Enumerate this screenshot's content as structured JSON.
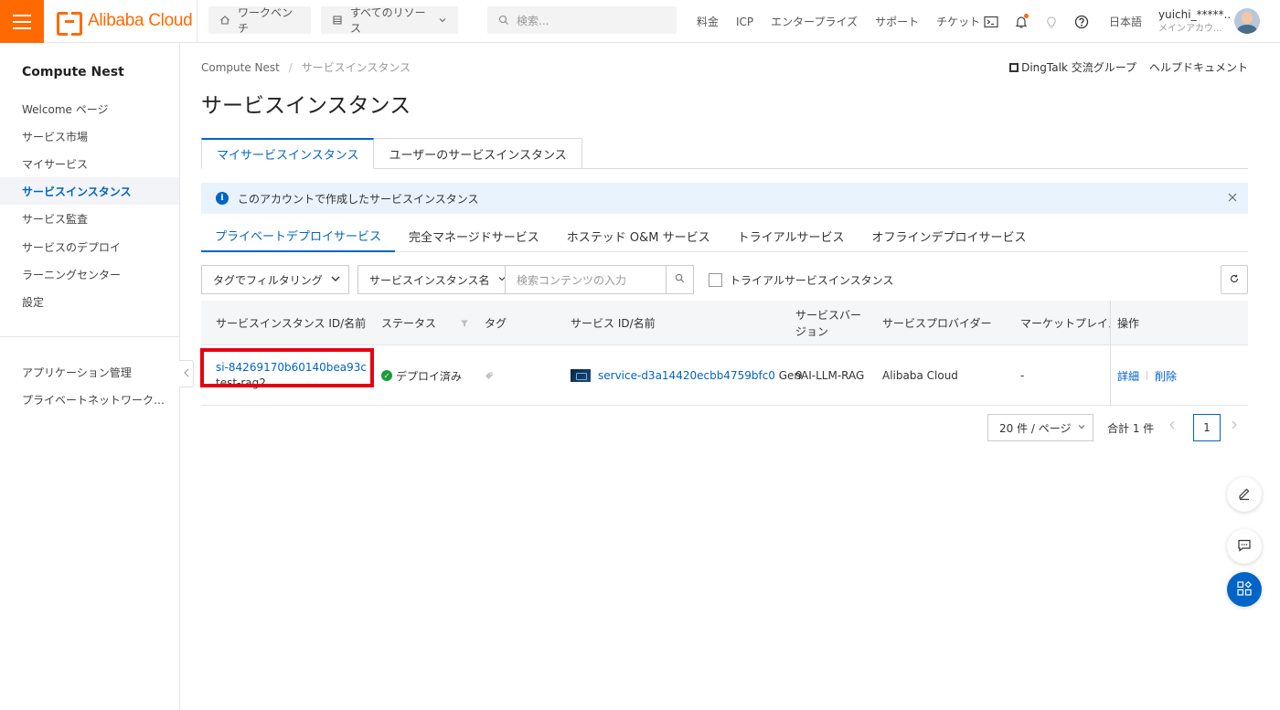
{
  "topbar": {
    "brand": "Alibaba Cloud",
    "workbench": "ワークベンチ",
    "resources": "すべてのリソース",
    "search_placeholder": "検索...",
    "links": [
      "料金",
      "ICP",
      "エンタープライズ",
      "サポート",
      "チケット"
    ],
    "language": "日本語",
    "user_name": "yuichi_*****...",
    "user_role": "メインアカウ..."
  },
  "sidebar": {
    "title": "Compute Nest",
    "items": [
      {
        "label": "Welcome ページ"
      },
      {
        "label": "サービス市場"
      },
      {
        "label": "マイサービス"
      },
      {
        "label": "サービスインスタンス"
      },
      {
        "label": "サービス監査"
      },
      {
        "label": "サービスのデプロイ"
      },
      {
        "label": "ラーニングセンター"
      },
      {
        "label": "設定"
      }
    ],
    "bottom_items": [
      {
        "label": "アプリケーション管理"
      },
      {
        "label": "プライベートネットワーク…"
      }
    ]
  },
  "breadcrumb": {
    "root": "Compute Nest",
    "current": "サービスインスタンス"
  },
  "help": {
    "dingtalk": "DingTalk 交流グループ",
    "docs": "ヘルプドキュメント"
  },
  "page_title": "サービスインスタンス",
  "tabs": [
    "マイサービスインスタンス",
    "ユーザーのサービスインスタンス"
  ],
  "notice": "このアカウントで作成したサービスインスタンス",
  "subtabs": [
    "プライベートデプロイサービス",
    "完全マネージドサービス",
    "ホステッド O&M サービス",
    "トライアルサービス",
    "オフラインデプロイサービス"
  ],
  "toolbar": {
    "tag_filter": "タグでフィルタリング",
    "field_select": "サービスインスタンス名",
    "search_placeholder": "検索コンテンツの入力",
    "trial_checkbox": "トライアルサービスインスタンス"
  },
  "table": {
    "headers": {
      "id": "サービスインスタンス ID/名前",
      "status": "ステータス",
      "tag": "タグ",
      "service": "サービス ID/名前",
      "version": "サービスバージョン",
      "provider": "サービスプロバイダー",
      "market": "マーケットプレイス",
      "ops": "操作"
    },
    "rows": [
      {
        "id": "si-84269170b60140bea93c",
        "name": "test-rag2",
        "status": "デプロイ済み",
        "service_id": "service-d3a14420ecbb4759bfc0",
        "service_name": "GenAI-LLM-RAG",
        "version": "9",
        "provider": "Alibaba Cloud",
        "market": "-",
        "op_detail": "詳細",
        "op_delete": "削除"
      }
    ]
  },
  "pagination": {
    "page_size": "20 件 / ページ",
    "total": "合計 1 件",
    "current": "1"
  }
}
